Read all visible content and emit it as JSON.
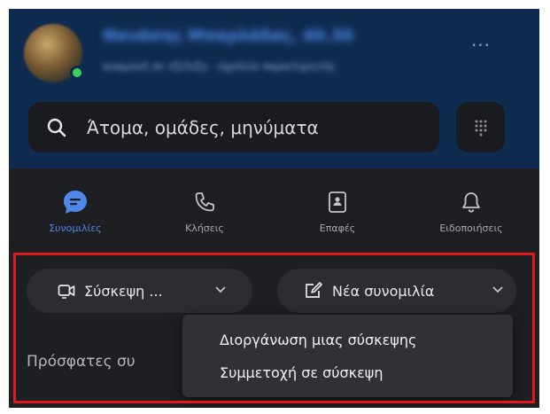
{
  "header": {
    "display_name": "Θανάσης Μπαρλάδας, 40.30",
    "status_text": "αναμονή σε εξέλιξη · σχολείο παρατηρητής",
    "more_label": "..."
  },
  "search": {
    "placeholder": "Άτομα, ομάδες, μηνύματα"
  },
  "tabs": [
    {
      "label": "Συνομιλίες",
      "icon": "chat-bubble-icon",
      "active": true
    },
    {
      "label": "Κλήσεις",
      "icon": "phone-icon",
      "active": false
    },
    {
      "label": "Επαφές",
      "icon": "contacts-icon",
      "active": false
    },
    {
      "label": "Ειδοποιήσεις",
      "icon": "bell-icon",
      "active": false
    }
  ],
  "actions": {
    "meeting_label": "Σύσκεψη ...",
    "new_chat_label": "Νέα συνομιλία"
  },
  "recent_label": "Πρόσφατες συ",
  "dropdown": {
    "items": [
      "Διοργάνωση μιας σύσκεψης",
      "Συμμετοχή σε σύσκεψη"
    ]
  },
  "colors": {
    "accent": "#4f88e8",
    "header_bg": "#0f2b4f",
    "highlight": "#e01a1a",
    "presence": "#3ecf5a"
  }
}
